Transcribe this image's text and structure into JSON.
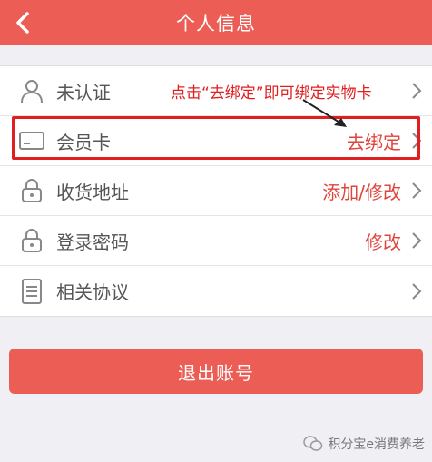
{
  "header": {
    "title": "个人信息"
  },
  "menu": [
    {
      "label": "未认证",
      "value": ""
    },
    {
      "label": "会员卡",
      "value": "去绑定"
    },
    {
      "label": "收货地址",
      "value": "添加/修改"
    },
    {
      "label": "登录密码",
      "value": "修改"
    },
    {
      "label": "相关协议",
      "value": ""
    }
  ],
  "annotation": "点击“去绑定”即可绑定实物卡",
  "logout_label": "退出账号",
  "watermark": "积分宝e消费养老",
  "colors": {
    "accent": "#ec5e55",
    "value_red": "#e0453d",
    "annotation_red": "#e02020"
  },
  "icons": [
    "back-arrow-icon",
    "user-icon",
    "card-icon",
    "lock-icon",
    "lock-icon",
    "document-icon",
    "chevron-right-icon",
    "wechat-icon"
  ]
}
